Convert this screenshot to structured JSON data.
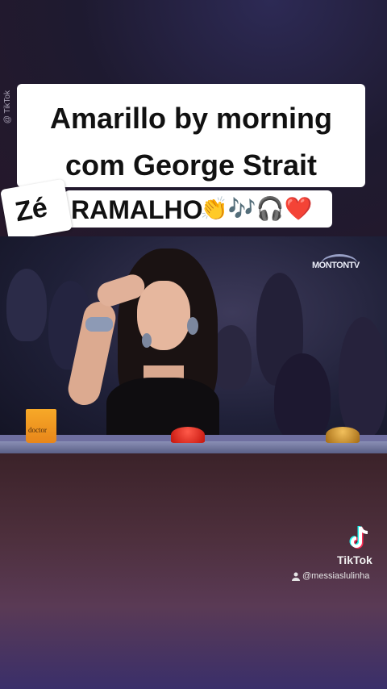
{
  "caption": {
    "line1": "Amarillo by morning",
    "line2": "com George Strait",
    "name_tag": "Zé",
    "subtitle": "RAMALHO",
    "emoji": "👏🎶🎧❤️"
  },
  "video": {
    "channel_logo": "MONTONTV",
    "cup_label": "doctor"
  },
  "watermark": {
    "platform": "TikTok",
    "handle": "@messiaslulinha",
    "side_text": "@ TikTok"
  },
  "colors": {
    "caption_bg": "#ffffff",
    "caption_text": "#111111",
    "red_button": "#e8281c",
    "gold_button": "#d8a23a"
  }
}
